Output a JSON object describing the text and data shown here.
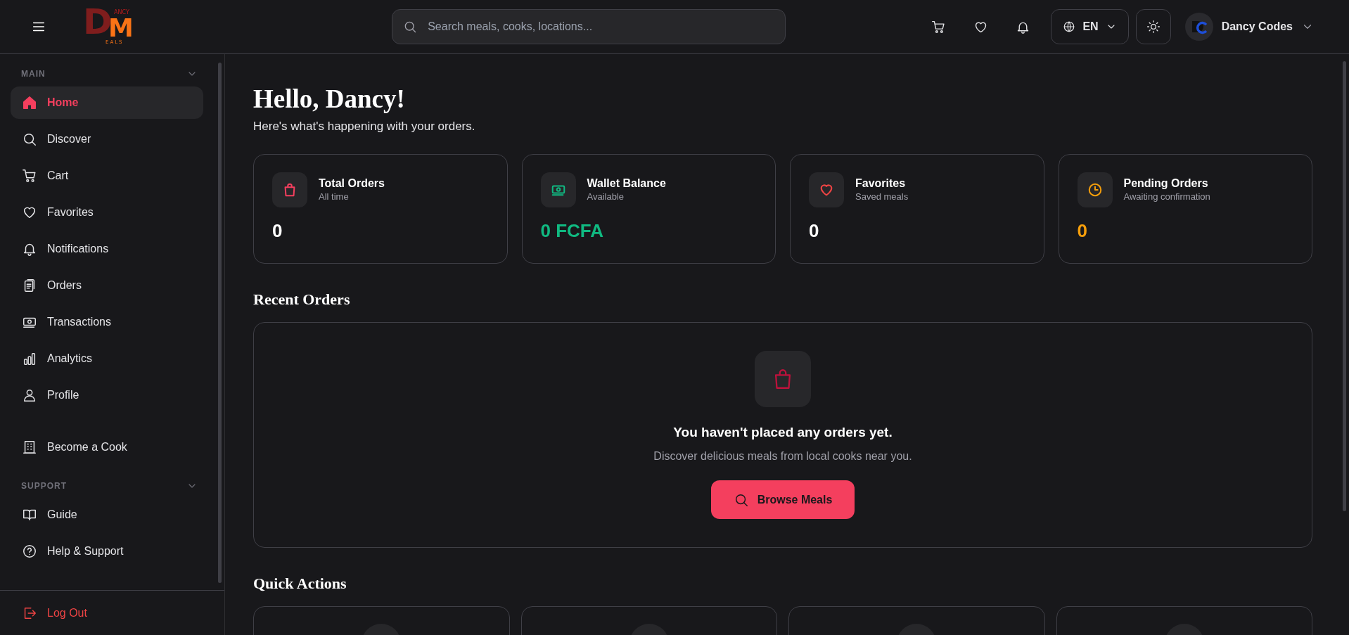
{
  "topbar": {
    "logo": {
      "initial": "D",
      "letter": "M",
      "top_text": "ANCY",
      "bottom_text": "EALS"
    },
    "search_placeholder": "Search meals, cooks, locations...",
    "language": "EN",
    "user_name": "Dancy Codes"
  },
  "sidebar": {
    "sections": [
      {
        "title": "MAIN",
        "expanded": true,
        "groups": [
          [
            {
              "label": "Home",
              "selected": true
            },
            {
              "label": "Discover",
              "selected": false
            },
            {
              "label": "Cart",
              "selected": false
            },
            {
              "label": "Favorites",
              "selected": false
            },
            {
              "label": "Notifications",
              "selected": false
            },
            {
              "label": "Orders",
              "selected": false
            },
            {
              "label": "Transactions",
              "selected": false
            },
            {
              "label": "Analytics",
              "selected": false
            },
            {
              "label": "Profile",
              "selected": false
            }
          ],
          [
            {
              "label": "Become a Cook",
              "selected": false
            }
          ]
        ]
      },
      {
        "title": "SUPPORT",
        "expanded": true,
        "groups": [
          [
            {
              "label": "Guide",
              "selected": false
            },
            {
              "label": "Help & Support",
              "selected": false
            }
          ]
        ]
      }
    ],
    "logout": "Log Out"
  },
  "greeting": {
    "title": "Hello, Dancy!",
    "subtitle": "Here's what's happening with your orders."
  },
  "stats": [
    {
      "title": "Total Orders",
      "subtitle": "All time",
      "value": "0",
      "color": "#f43f5e",
      "highlighted": false
    },
    {
      "title": "Wallet Balance",
      "subtitle": "Available",
      "value": "0 FCFA",
      "color": "#10b981",
      "highlighted": true
    },
    {
      "title": "Favorites",
      "subtitle": "Saved meals",
      "value": "0",
      "color": "#ef4444",
      "highlighted": false
    },
    {
      "title": "Pending Orders",
      "subtitle": "Awaiting confirmation",
      "value": "0",
      "color": "#f59e0b",
      "highlighted": true
    }
  ],
  "recent_orders": {
    "title": "Recent Orders",
    "empty_title": "You haven't placed any orders yet.",
    "empty_text": "Discover delicious meals from local cooks near you.",
    "button": "Browse Meals"
  },
  "quick_actions": {
    "title": "Quick Actions",
    "cards": [
      {
        "kind": "action"
      },
      {
        "kind": "action"
      },
      {
        "kind": "action"
      },
      {
        "kind": "action"
      }
    ]
  }
}
